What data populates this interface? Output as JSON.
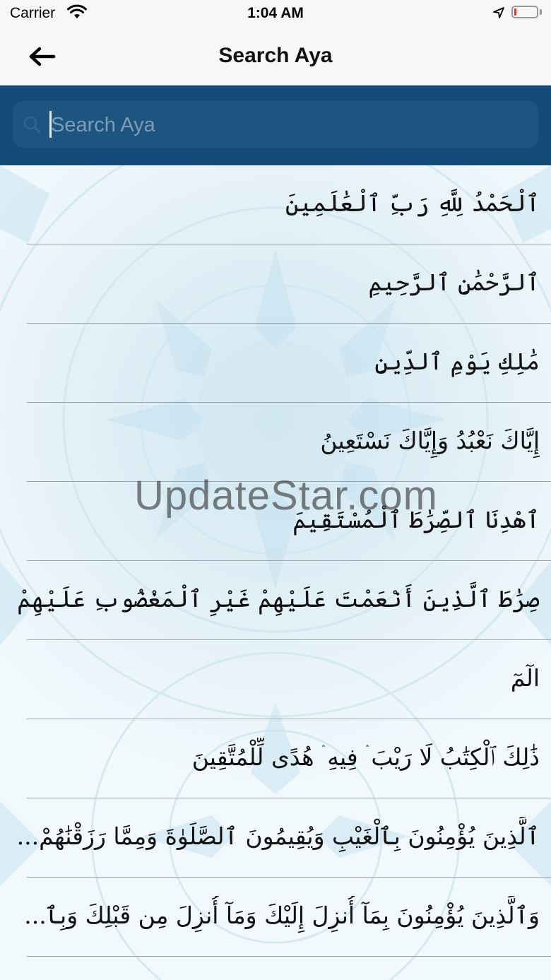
{
  "status_bar": {
    "carrier": "Carrier",
    "time": "1:04 AM",
    "icons": [
      "wifi-icon",
      "location-arrow-icon",
      "battery-icon"
    ]
  },
  "nav": {
    "title": "Search Aya",
    "back_icon": "back-arrow-icon"
  },
  "search": {
    "placeholder": "Search Aya",
    "value": "",
    "icon": "search-icon"
  },
  "ayas": [
    "ٱلْحَمْدُ لِلَّهِ رَبِّ ٱلْعَٰلَمِينَ",
    "ٱلرَّحْمَٰنِ ٱلرَّحِيمِ",
    "مَٰلِكِ يَوْمِ ٱلدِّينِ",
    "إِيَّاكَ نَعْبُدُ وَإِيَّاكَ نَسْتَعِينُ",
    "ٱهْدِنَا ٱلصِّرَٰطَ ٱلْمُسْتَقِيمَ",
    "صِرَٰطَ ٱلَّذِينَ أَنْعَمْتَ عَلَيْهِمْ غَيْرِ ٱلْمَغْضُوبِ عَلَيْهِمْ وَلَا ٱل...",
    "الٓمٓ",
    "ذَٰلِكَ ٱلْكِتَٰبُ لَا رَيْبَ ۛ فِيهِ ۛ هُدًى لِّلْمُتَّقِينَ",
    "ٱلَّذِينَ يُؤْمِنُونَ بِٱلْغَيْبِ وَيُقِيمُونَ ٱلصَّلَوٰةَ وَمِمَّا رَزَقْنَٰهُمْ...",
    "وَٱلَّذِينَ يُؤْمِنُونَ بِمَآ أُنزِلَ إِلَيْكَ وَمَآ أُنزِلَ مِن قَبْلِكَ وَبِٱ..."
  ],
  "watermark": "UpdateStar.com",
  "colors": {
    "header_bg": "#134b79",
    "search_field_bg": "#1d5581",
    "divider": "#9aa4ab"
  }
}
